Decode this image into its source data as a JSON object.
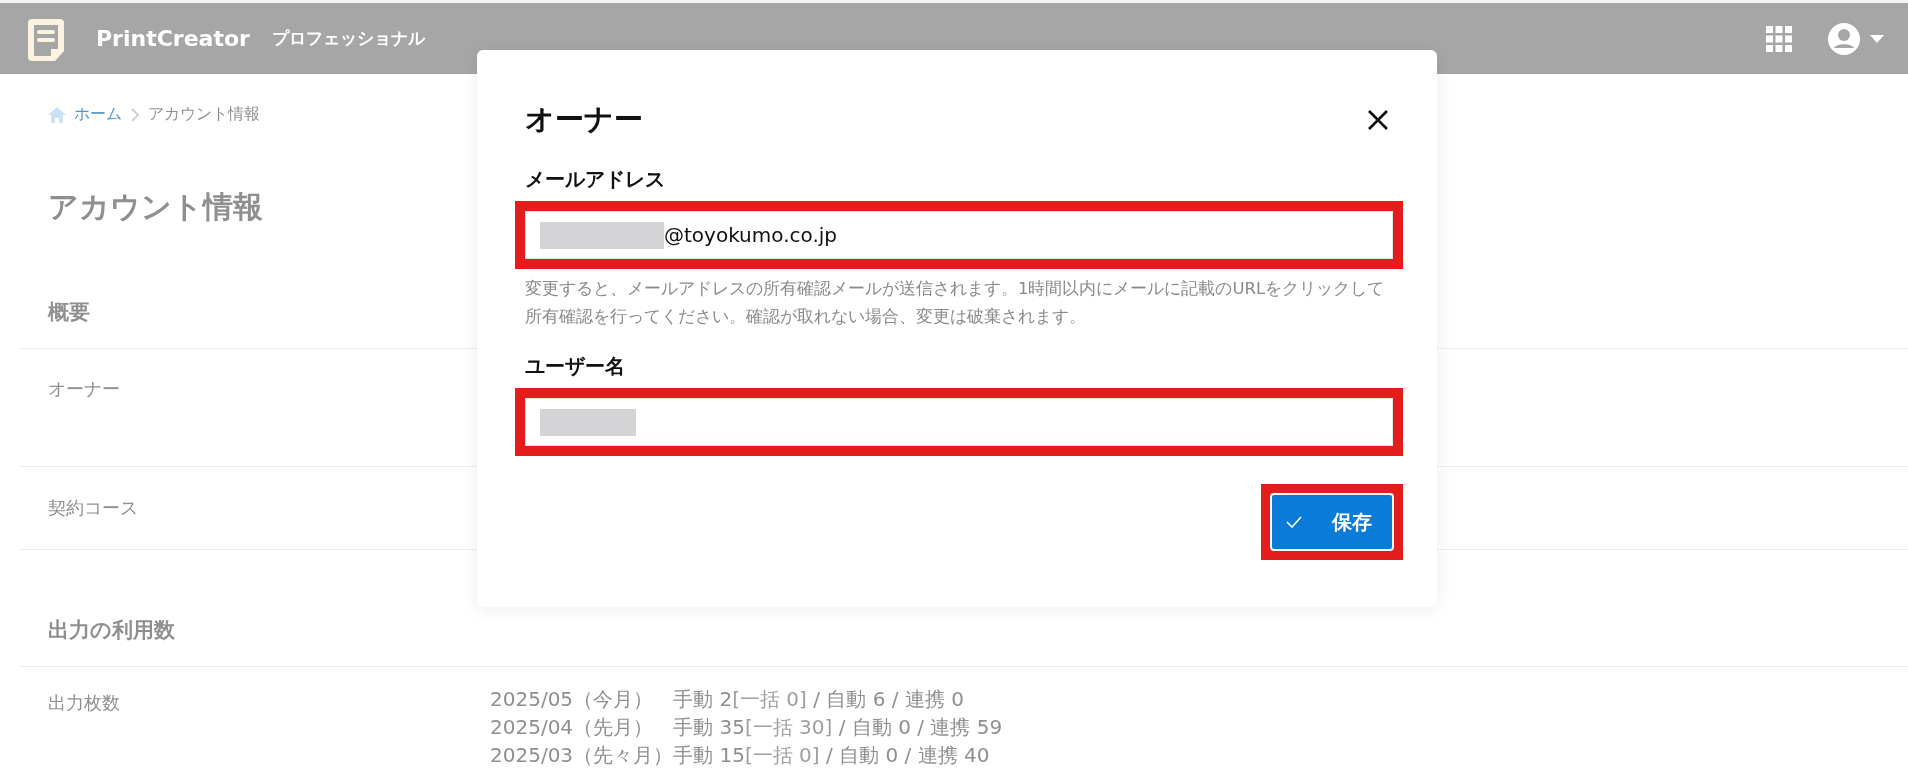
{
  "header": {
    "app_name": "PrintCreator",
    "plan": "プロフェッショナル"
  },
  "breadcrumb": [
    {
      "label": "ホーム",
      "kind": "link"
    },
    {
      "label": "アカウント情報",
      "kind": "current"
    }
  ],
  "page_title": "アカウント情報",
  "sections": [
    {
      "title": "概要",
      "rows": [
        {
          "label": "オーナー",
          "kind": "tall"
        },
        {
          "label": "契約コース",
          "kind": "short"
        }
      ]
    },
    {
      "title": "出力の利用数",
      "rows": [
        {
          "label": "出力枚数",
          "kind": "usage"
        }
      ]
    }
  ],
  "usage": [
    {
      "month": "2025/05（今月）",
      "manual": "手動 2",
      "bulk": "[一括 0]",
      "rest": "/ 自動 6 / 連携 0"
    },
    {
      "month": "2025/04（先月）",
      "manual": "手動 35",
      "bulk": "[一括 30]",
      "rest": "/ 自動 0 / 連携 59"
    },
    {
      "month": "2025/03（先々月）",
      "manual": "手動 15",
      "bulk": "[一括 0]",
      "rest": "/ 自動 0 / 連携 40"
    }
  ],
  "dialog": {
    "title": "オーナー",
    "fields": [
      {
        "label": "メールアドレス",
        "value": "@toyokumo.co.jp",
        "redacted": true,
        "highlighted": true,
        "help": "変更すると、メールアドレスの所有確認メールが送信されます。1時間以内にメールに記載のURLをクリックして所有確認を行ってください。確認が取れない場合、変更は破棄されます。"
      },
      {
        "label": "ユーザー名",
        "redacted": true,
        "highlighted": true
      }
    ],
    "save_button": {
      "label": "保存",
      "highlighted": true
    }
  }
}
